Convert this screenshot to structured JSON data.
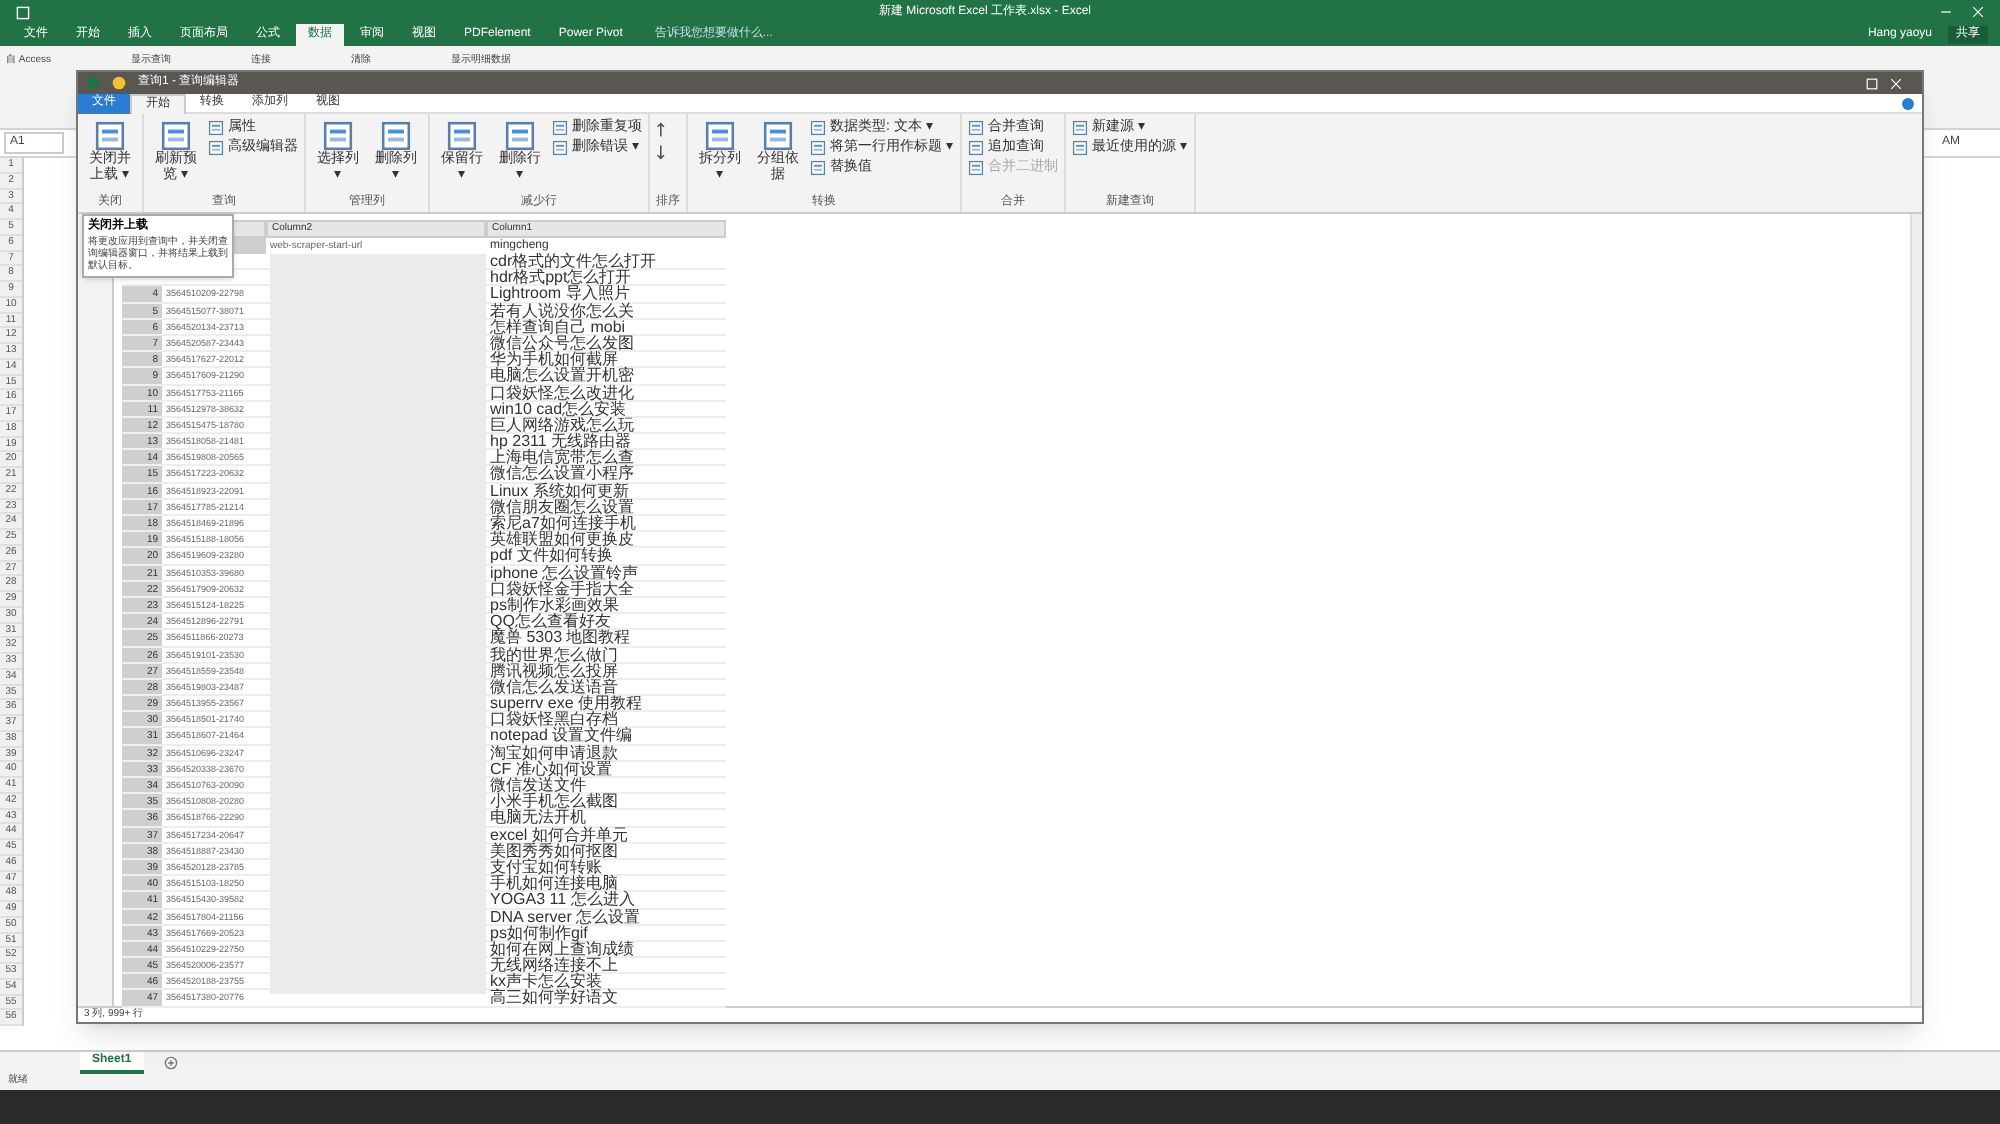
{
  "excel": {
    "title": "新建 Microsoft Excel 工作表.xlsx - Excel",
    "tabs": [
      {
        "label": "文件",
        "selected": false
      },
      {
        "label": "开始",
        "selected": false
      },
      {
        "label": "插入",
        "selected": false
      },
      {
        "label": "页面布局",
        "selected": false
      },
      {
        "label": "公式",
        "selected": false
      },
      {
        "label": "数据",
        "selected": true
      },
      {
        "label": "审阅",
        "selected": false
      },
      {
        "label": "视图",
        "selected": false
      },
      {
        "label": "PDFelement",
        "selected": false
      },
      {
        "label": "Power Pivot",
        "selected": false
      }
    ],
    "tell_me": "告诉我您想要做什么...",
    "user": "Hang yaoyu",
    "share": "共享",
    "ribbon_items": [
      "自 Access",
      "显示查询",
      "连接",
      "清除",
      "显示明细数据"
    ],
    "name_box": "A1",
    "column_label": "AM",
    "row_numbers": [
      "1",
      "2",
      "3",
      "4",
      "5",
      "6",
      "7",
      "8",
      "9",
      "10",
      "11",
      "12",
      "13",
      "14",
      "15",
      "16",
      "17",
      "18",
      "19",
      "20",
      "21",
      "22",
      "23",
      "24",
      "25",
      "26",
      "27",
      "28",
      "29",
      "30",
      "31",
      "32",
      "33",
      "34",
      "35",
      "36",
      "37",
      "38",
      "39",
      "40",
      "41",
      "42",
      "43",
      "44",
      "45",
      "46",
      "47",
      "48",
      "49",
      "50",
      "51",
      "52",
      "53",
      "54",
      "55",
      "56"
    ],
    "sheet_tab": "Sheet1",
    "status": "就绪"
  },
  "editor": {
    "title": "查询1 - 查询编辑器",
    "tabs": [
      {
        "label": "文件",
        "kind": "file"
      },
      {
        "label": "开始",
        "kind": "tab",
        "selected": true
      },
      {
        "label": "转换",
        "kind": "tab",
        "selected": false
      },
      {
        "label": "添加列",
        "kind": "tab",
        "selected": false
      },
      {
        "label": "视图",
        "kind": "tab",
        "selected": false
      }
    ],
    "groups": [
      {
        "label": "关闭",
        "items": [
          {
            "kind": "large",
            "label": "关闭并上载 ▾"
          }
        ]
      },
      {
        "label": "查询",
        "items": [
          {
            "kind": "large",
            "label": "刷新预览 ▾"
          },
          {
            "kind": "small",
            "label": "属性"
          },
          {
            "kind": "small",
            "label": "高级编辑器"
          }
        ]
      },
      {
        "label": "管理列",
        "items": [
          {
            "kind": "large",
            "label": "选择列 ▾"
          },
          {
            "kind": "large",
            "label": "删除列 ▾"
          }
        ]
      },
      {
        "label": "减少行",
        "items": [
          {
            "kind": "large",
            "label": "保留行 ▾"
          },
          {
            "kind": "large",
            "label": "删除行 ▾"
          },
          {
            "kind": "small",
            "label": "删除重复项"
          },
          {
            "kind": "small",
            "label": "删除错误 ▾"
          }
        ]
      },
      {
        "label": "排序",
        "items": [
          {
            "kind": "sort"
          }
        ]
      },
      {
        "label": "转换",
        "items": [
          {
            "kind": "large",
            "label": "拆分列 ▾"
          },
          {
            "kind": "large",
            "label": "分组依据"
          },
          {
            "kind": "small",
            "label": "数据类型: 文本 ▾"
          },
          {
            "kind": "small",
            "label": "将第一行用作标题 ▾"
          },
          {
            "kind": "small",
            "label": "替换值"
          }
        ]
      },
      {
        "label": "合并",
        "items": [
          {
            "kind": "small",
            "label": "合并查询"
          },
          {
            "kind": "small",
            "label": "追加查询"
          },
          {
            "kind": "small",
            "label": "合并二进制",
            "disabled": true
          }
        ]
      },
      {
        "label": "新建查询",
        "items": [
          {
            "kind": "small",
            "label": "新建源 ▾"
          },
          {
            "kind": "small",
            "label": "最近使用的源 ▾"
          }
        ]
      }
    ],
    "tooltip": {
      "title": "关闭并上载",
      "text": "将更改应用到查询中，并关闭查询编辑器窗口，并将结果上载到默认目标。"
    },
    "table": {
      "columns": [
        "Column2",
        "Column1"
      ],
      "first_row": {
        "column_2": "web-scraper-start-url",
        "column_1": "mingcheng"
      },
      "rows": [
        {
          "title": "cdr格式的文件怎么打开"
        },
        {
          "title": "hdr格式ppt怎么打开"
        },
        {
          "n": "4",
          "id": "3564510209-22798",
          "title": "Lightroom 导入照片"
        },
        {
          "n": "5",
          "id": "3564515077-38071",
          "title": "若有人说没你怎么关"
        },
        {
          "n": "6",
          "id": "3564520134-23713",
          "title": "怎样查询自己 mobi"
        },
        {
          "n": "7",
          "id": "3564520587-23443",
          "title": "微信公众号怎么发图"
        },
        {
          "n": "8",
          "id": "3564517627-22012",
          "title": "华为手机如何截屏"
        },
        {
          "n": "9",
          "id": "3564517609-21290",
          "title": "电脑怎么设置开机密"
        },
        {
          "n": "10",
          "id": "3564517753-21165",
          "title": "口袋妖怪怎么改进化"
        },
        {
          "n": "11",
          "id": "3564512978-38632",
          "title": "win10 cad怎么安装"
        },
        {
          "n": "12",
          "id": "3564515475-18780",
          "title": "巨人网络游戏怎么玩"
        },
        {
          "n": "13",
          "id": "3564518058-21481",
          "title": "hp 2311 无线路由器"
        },
        {
          "n": "14",
          "id": "3564519808-20565",
          "title": "上海电信宽带怎么查"
        },
        {
          "n": "15",
          "id": "3564517223-20632",
          "title": "微信怎么设置小程序"
        },
        {
          "n": "16",
          "id": "3564518923-22091",
          "title": "Linux 系统如何更新"
        },
        {
          "n": "17",
          "id": "3564517785-21214",
          "title": "微信朋友圈怎么设置"
        },
        {
          "n": "18",
          "id": "3564518469-21896",
          "title": "索尼a7如何连接手机"
        },
        {
          "n": "19",
          "id": "3564515188-18056",
          "title": "英雄联盟如何更换皮"
        },
        {
          "n": "20",
          "id": "3564519609-23280",
          "title": "pdf 文件如何转换"
        },
        {
          "n": "21",
          "id": "3564510353-39680",
          "title": "iphone 怎么设置铃声"
        },
        {
          "n": "22",
          "id": "3564517909-20632",
          "title": "口袋妖怪金手指大全"
        },
        {
          "n": "23",
          "id": "3564515124-18225",
          "title": "ps制作水彩画效果"
        },
        {
          "n": "24",
          "id": "3564512896-22791",
          "title": "QQ怎么查看好友"
        },
        {
          "n": "25",
          "id": "3564511866-20273",
          "title": "魔兽 5303 地图教程"
        },
        {
          "n": "26",
          "id": "3564519101-23530",
          "title": "我的世界怎么做门"
        },
        {
          "n": "27",
          "id": "3564518559-23548",
          "title": "腾讯视频怎么投屏"
        },
        {
          "n": "28",
          "id": "3564519803-23487",
          "title": "微信怎么发送语音"
        },
        {
          "n": "29",
          "id": "3564513955-23567",
          "title": "superrv exe 使用教程"
        },
        {
          "n": "30",
          "id": "3564518501-21740",
          "title": "口袋妖怪黑白存档"
        },
        {
          "n": "31",
          "id": "3564518607-21464",
          "title": "notepad 设置文件编"
        },
        {
          "n": "32",
          "id": "3564510696-23247",
          "title": "淘宝如何申请退款"
        },
        {
          "n": "33",
          "id": "3564520338-23670",
          "title": "CF 准心如何设置"
        },
        {
          "n": "34",
          "id": "3564510763-20090",
          "title": "微信发送文件"
        },
        {
          "n": "35",
          "id": "3564510808-20280",
          "title": "小米手机怎么截图"
        },
        {
          "n": "36",
          "id": "3564518766-22290",
          "title": "电脑无法开机"
        },
        {
          "n": "37",
          "id": "3564517234-20647",
          "title": "excel 如何合并单元"
        },
        {
          "n": "38",
          "id": "3564518887-23430",
          "title": "美图秀秀如何抠图"
        },
        {
          "n": "39",
          "id": "3564520128-23785",
          "title": "支付宝如何转账"
        },
        {
          "n": "40",
          "id": "3564515103-18250",
          "title": "手机如何连接电脑"
        },
        {
          "n": "41",
          "id": "3564515430-39582",
          "title": "YOGA3 11 怎么进入"
        },
        {
          "n": "42",
          "id": "3564517804-21156",
          "title": "DNA server 怎么设置"
        },
        {
          "n": "43",
          "id": "3564517669-20523",
          "title": "ps如何制作gif"
        },
        {
          "n": "44",
          "id": "3564510229-22750",
          "title": "如何在网上查询成绩"
        },
        {
          "n": "45",
          "id": "3564520006-23577",
          "title": "无线网络连接不上"
        },
        {
          "n": "46",
          "id": "3564520188-23755",
          "title": "kx声卡怎么安装"
        },
        {
          "n": "47",
          "id": "3564517380-20776",
          "title": "高三如何学好语文"
        }
      ]
    },
    "status": "3 列, 999+ 行"
  }
}
